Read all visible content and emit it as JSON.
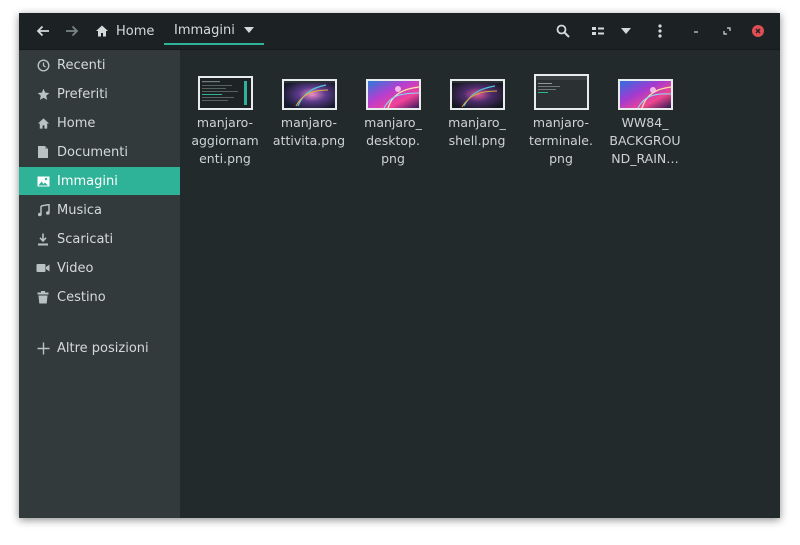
{
  "header": {
    "back_icon": "arrow-left-icon",
    "forward_icon": "arrow-right-icon",
    "breadcrumbs": [
      {
        "label": "Home",
        "icon": "home-icon"
      },
      {
        "label": "Immagini"
      }
    ],
    "accent": "#2eb398"
  },
  "sidebar": {
    "items": [
      {
        "label": "Recenti",
        "icon": "clock-icon"
      },
      {
        "label": "Preferiti",
        "icon": "star-icon"
      },
      {
        "label": "Home",
        "icon": "home-icon"
      },
      {
        "label": "Documenti",
        "icon": "document-icon"
      },
      {
        "label": "Immagini",
        "icon": "image-icon",
        "active": true
      },
      {
        "label": "Musica",
        "icon": "music-icon"
      },
      {
        "label": "Scaricati",
        "icon": "download-icon"
      },
      {
        "label": "Video",
        "icon": "video-icon"
      },
      {
        "label": "Cestino",
        "icon": "trash-icon"
      },
      {
        "label": "Altre posizioni",
        "icon": "plus-icon"
      }
    ]
  },
  "files": [
    {
      "name": "manjaro-\naggiornam\nenti.png",
      "thumb": "terminal-screenshot"
    },
    {
      "name": "manjaro-\nattivita.png",
      "thumb": "desktop-screenshot"
    },
    {
      "name": "manjaro_\ndesktop.\npng",
      "thumb": "wallpaper"
    },
    {
      "name": "manjaro_\nshell.png",
      "thumb": "desktop-screenshot"
    },
    {
      "name": "manjaro-\nterminale.\npng",
      "thumb": "terminal-screenshot"
    },
    {
      "name": "WW84_\nBACKGROU\nND_RAIN…",
      "thumb": "wallpaper"
    }
  ]
}
